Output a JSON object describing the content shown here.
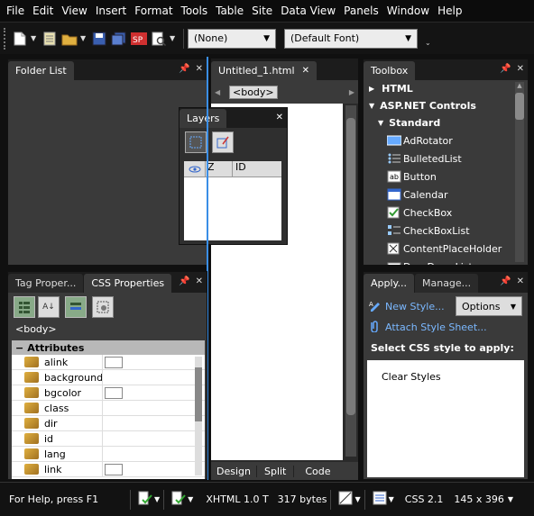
{
  "menu": [
    "File",
    "Edit",
    "View",
    "Insert",
    "Format",
    "Tools",
    "Table",
    "Site",
    "Data View",
    "Panels",
    "Window",
    "Help"
  ],
  "toolbar": {
    "style_combo": "(None)",
    "font_combo": "(Default Font)"
  },
  "folder_list": {
    "title": "Folder List"
  },
  "document": {
    "tab": "Untitled_1.html",
    "tag": "<body>",
    "view_tabs": [
      "Design",
      "Split",
      "Code"
    ]
  },
  "layers": {
    "title": "Layers",
    "cols": [
      "Z",
      "ID"
    ]
  },
  "tag_props": {
    "tabs": [
      "Tag Proper...",
      "CSS Properties"
    ],
    "selected_tag": "<body>",
    "section": "Attributes",
    "attributes": [
      "alink",
      "background",
      "bgcolor",
      "class",
      "dir",
      "id",
      "lang",
      "link"
    ]
  },
  "toolbox": {
    "title": "Toolbox",
    "groups": [
      "HTML",
      "ASP.NET Controls",
      "Standard"
    ],
    "items": [
      "AdRotator",
      "BulletedList",
      "Button",
      "Calendar",
      "CheckBox",
      "CheckBoxList",
      "ContentPlaceHolder",
      "DropDownList"
    ]
  },
  "apply_styles": {
    "tabs": [
      "Apply...",
      "Manage..."
    ],
    "new_style": "New Style...",
    "options": "Options",
    "attach": "Attach Style Sheet...",
    "heading": "Select CSS style to apply:",
    "list": [
      "Clear Styles"
    ]
  },
  "status": {
    "help": "For Help, press F1",
    "doctype": "XHTML 1.0 T",
    "size": "317 bytes",
    "css": "CSS 2.1",
    "dims": "145 x 396"
  }
}
